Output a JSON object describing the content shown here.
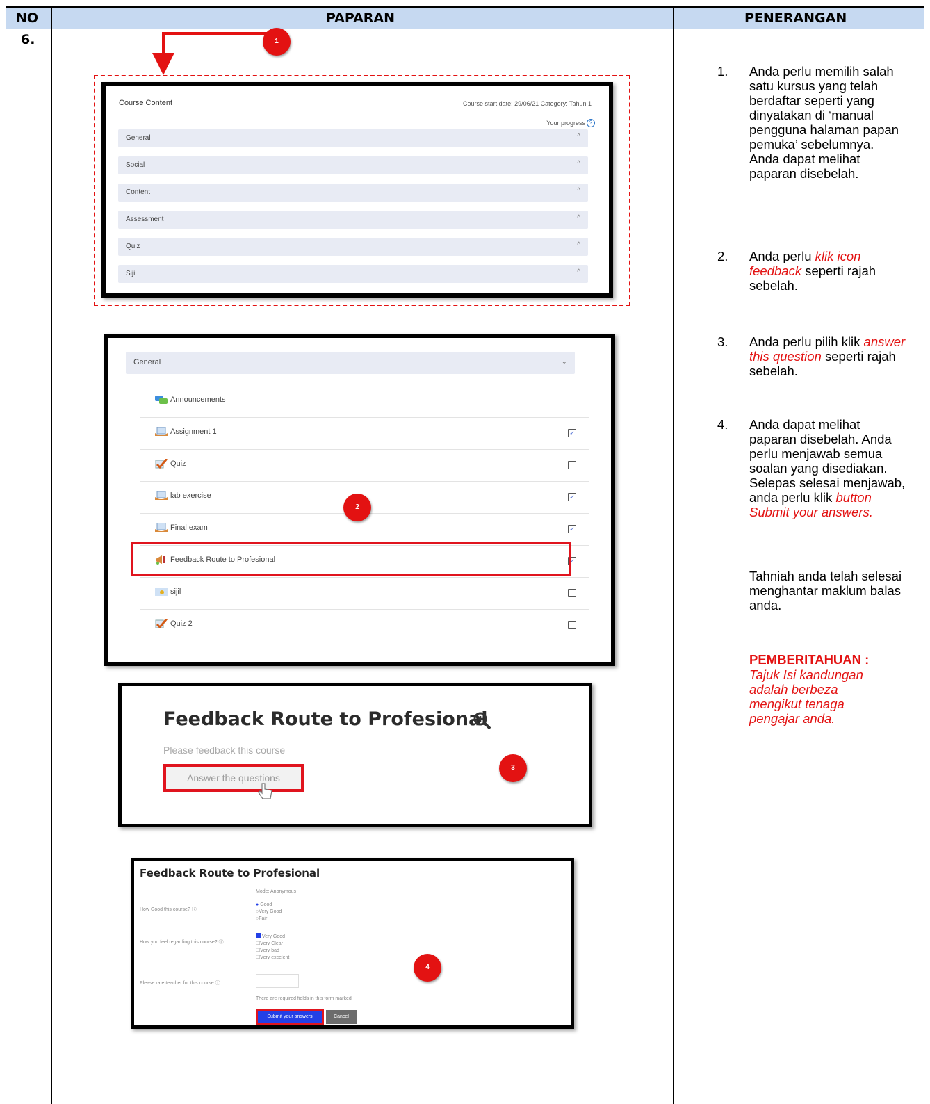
{
  "header": {
    "col_no": "NO",
    "col_paparan": "PAPARAN",
    "col_penerangan": "PENERANGAN"
  },
  "row_number": "6.",
  "badges": [
    "1",
    "2",
    "3",
    "4"
  ],
  "shot1": {
    "title": "Course Content",
    "meta": "Course start date: 29/06/21   Category: Tahun 1",
    "progress_label": "Your progress",
    "sections": [
      "General",
      "Social",
      "Content",
      "Assessment",
      "Quiz",
      "Sijil"
    ]
  },
  "shot2": {
    "section": "General",
    "items": [
      {
        "label": "Announcements",
        "icon": "forum-icon",
        "check": "none"
      },
      {
        "label": "Assignment 1",
        "icon": "assignment-icon",
        "check": "checked"
      },
      {
        "label": "Quiz",
        "icon": "quiz-icon",
        "check": "empty"
      },
      {
        "label": "lab exercise",
        "icon": "assignment-icon",
        "check": "checked"
      },
      {
        "label": "Final exam",
        "icon": "assignment-icon",
        "check": "checked"
      },
      {
        "label": "Feedback Route to Profesional",
        "icon": "feedback-icon",
        "check": "checked"
      },
      {
        "label": "sijil",
        "icon": "certificate-icon",
        "check": "empty"
      },
      {
        "label": "Quiz 2",
        "icon": "quiz-icon",
        "check": "empty"
      }
    ]
  },
  "shot3": {
    "title": "Feedback Route to Profesional",
    "subtitle": "Please feedback this course",
    "answer_button": "Answer the questions"
  },
  "shot4": {
    "title": "Feedback Route to Profesional",
    "mode": "Mode: Anonymous",
    "q1": "How Good this course?",
    "q1_options": [
      "Good",
      "Very Good",
      "Fair"
    ],
    "q2": "How you feel regarding this course?",
    "q2_options": [
      "Very Good",
      "Very Clear",
      "Very bad",
      "Very excelent"
    ],
    "q3": "Please rate teacher for this course",
    "required_note": "There are required fields in this form marked",
    "submit_label": "Submit your answers",
    "cancel_label": "Cancel"
  },
  "steps": [
    {
      "num": "1.",
      "text": "Anda perlu memilih salah satu kursus yang telah berdaftar seperti yang dinyatakan di ‘manual pengguna halaman papan pemuka’ sebelumnya. Anda dapat melihat paparan disebelah."
    },
    {
      "num": "2.",
      "pre": "Anda perlu ",
      "em": "klik icon feedback",
      "post": " seperti rajah sebelah."
    },
    {
      "num": "3.",
      "pre": "Anda perlu pilih klik ",
      "em": "answer this question",
      "post": " seperti rajah sebelah."
    },
    {
      "num": "4.",
      "pre": "Anda dapat melihat paparan disebelah. Anda perlu menjawab semua soalan yang disediakan. Selepas selesai menjawab, anda perlu klik ",
      "em": "button Submit your answers.",
      "post": ""
    }
  ],
  "congrats": "Tahniah anda telah selesai menghantar maklum balas anda.",
  "notice_title": "PEMBERITAHUAN :",
  "notice_text": "Tajuk Isi kandungan adalah berbeza mengikut tenaga pengajar anda.",
  "colors": {
    "header_bg": "#c6d9f1",
    "accent_red": "#e31212",
    "submit_blue": "#2340e6"
  }
}
